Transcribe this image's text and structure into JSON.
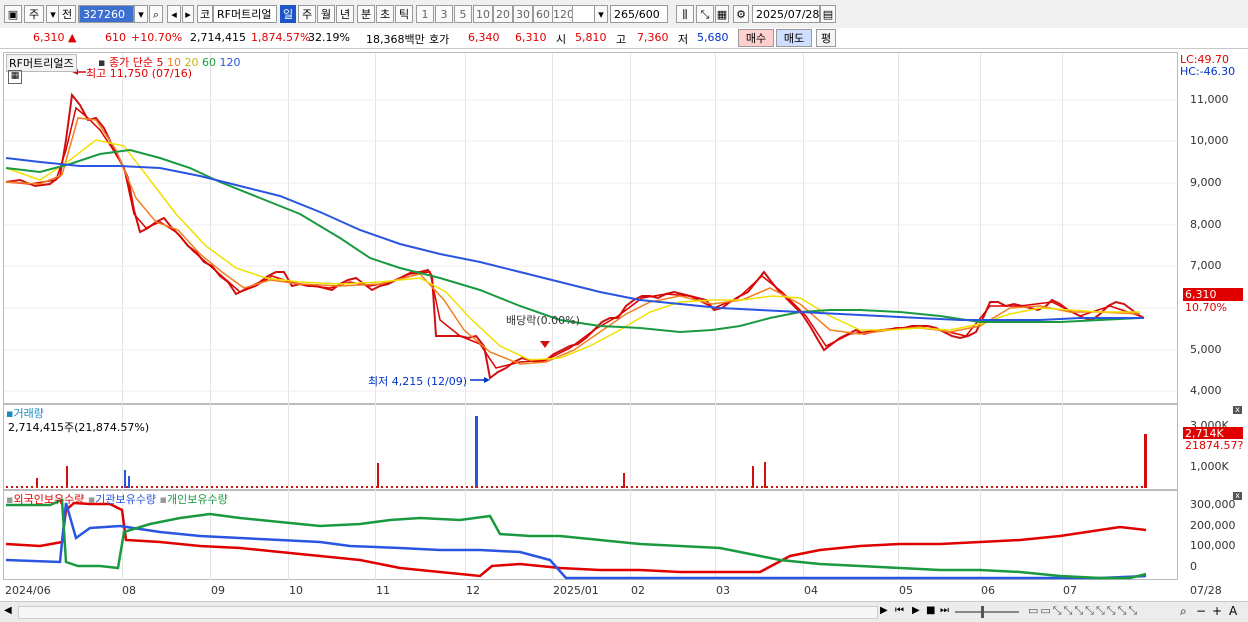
{
  "toolbar": {
    "market": "주",
    "period_type": "전",
    "stock_code": "327260",
    "corp_prefix": "코",
    "stock_name": "RF머트리얼",
    "intervals": [
      "일",
      "주",
      "월",
      "년",
      "분",
      "초",
      "틱"
    ],
    "selected_interval": "일",
    "min_steps": [
      "1",
      "3",
      "5",
      "10",
      "20",
      "30",
      "60",
      "120"
    ],
    "count": "265",
    "count_max": "/600",
    "date": "2025/07/28"
  },
  "quote": {
    "price": "6,310",
    "change": "610",
    "change_pct": "+10.70%",
    "volume": "2,714,415",
    "volume_pct": "1,874.57%",
    "turnover": "32.19%",
    "amount": "18,368백만",
    "ask_label": "호가",
    "ask1": "6,340",
    "ask2": "6,310",
    "open_label": "시",
    "open": "5,810",
    "high_label": "고",
    "high": "7,360",
    "low_label": "저",
    "low": "5,680",
    "buy": "매수",
    "sell": "매도",
    "eval": "평"
  },
  "legend": {
    "title": "RF머트리얼즈",
    "ma_label": "종가 단순",
    "periods": [
      "5",
      "10",
      "20",
      "60",
      "120"
    ],
    "colors": [
      "#e00000",
      "#f08020",
      "#f0e000",
      "#1a9a40",
      "#2a55e0"
    ]
  },
  "annotations": {
    "high": "최고 11,750 (07/16)",
    "low": "최저 4,215 (12/09)",
    "dividend": "배당락(0.00%)"
  },
  "right_axis": {
    "lc": "LC:49.70",
    "hc": "HC:-46.30",
    "price_tag": "6,310",
    "pct_tag": "10.70%",
    "price_ticks": [
      "11,000",
      "10,000",
      "9,000",
      "8,000",
      "7,000",
      "6,000",
      "5,000",
      "4,000"
    ],
    "vol_ticks": [
      "3,000K",
      "1,000K"
    ],
    "vol_tag": "2,714K",
    "vol_pct_tag": "21874.57?",
    "hold_ticks": [
      "300,000",
      "200,000",
      "100,000",
      "0"
    ]
  },
  "volume_panel": {
    "title": "거래량",
    "value": "2,714,415주(21,874.57%)"
  },
  "holdings_panel": {
    "series": [
      "외국인보유수량",
      "기관보유수량",
      "개인보유수량"
    ],
    "colors": [
      "#e00000",
      "#2a55e0",
      "#1a9a40"
    ]
  },
  "x_axis": [
    "2024/06",
    "08",
    "09",
    "10",
    "11",
    "12",
    "2025/01",
    "02",
    "03",
    "04",
    "05",
    "06",
    "07",
    "07/28"
  ],
  "chart_data": {
    "type": "candlestick",
    "title": "RF머트리얼즈",
    "ylim": [
      4000,
      11750
    ],
    "ma_periods": [
      5,
      10,
      20,
      60,
      120
    ],
    "close_approx": [
      {
        "x": "2024/06",
        "y": 9100
      },
      {
        "x": "07",
        "y": 11750
      },
      {
        "x": "08",
        "y": 7900
      },
      {
        "x": "09",
        "y": 6400
      },
      {
        "x": "10",
        "y": 6600
      },
      {
        "x": "11",
        "y": 6900
      },
      {
        "x": "12",
        "y": 4215
      },
      {
        "x": "2025/01",
        "y": 5800
      },
      {
        "x": "02",
        "y": 6500
      },
      {
        "x": "03",
        "y": 6500
      },
      {
        "x": "04",
        "y": 5300
      },
      {
        "x": "05",
        "y": 5400
      },
      {
        "x": "06",
        "y": 6000
      },
      {
        "x": "07",
        "y": 5900
      },
      {
        "x": "07/28",
        "y": 6310
      }
    ]
  }
}
